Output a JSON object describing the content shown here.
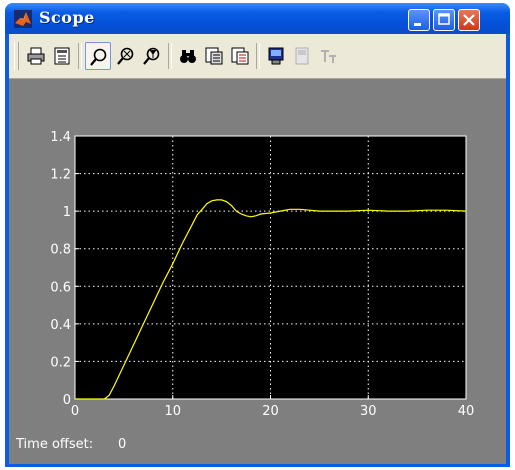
{
  "window": {
    "title": "Scope"
  },
  "toolbar": {
    "buttons": [
      {
        "icon": "print-icon"
      },
      {
        "icon": "parameters-icon"
      },
      {
        "icon": "zoom-icon",
        "pressed": true
      },
      {
        "icon": "zoom-x-icon"
      },
      {
        "icon": "zoom-y-icon"
      },
      {
        "icon": "autoscale-icon"
      },
      {
        "icon": "save-axes-icon"
      },
      {
        "icon": "restore-axes-icon"
      },
      {
        "icon": "floating-scope-icon"
      },
      {
        "icon": "lock-axes-icon",
        "disabled": true
      },
      {
        "icon": "signal-selection-icon",
        "disabled": true
      }
    ]
  },
  "status": {
    "time_offset_label": "Time offset:",
    "time_offset_value": "0"
  },
  "colors": {
    "plot_bg": "#000000",
    "figure_bg": "#7f7f7f",
    "line": "#ffff00",
    "grid": "#ffffff"
  },
  "chart_data": {
    "type": "line",
    "grid": true,
    "xlim": [
      0,
      40
    ],
    "ylim": [
      0,
      1.4
    ],
    "x_ticks": [
      "0",
      "10",
      "20",
      "30",
      "40"
    ],
    "y_ticks": [
      "0",
      "0.2",
      "0.4",
      "0.6",
      "0.8",
      "1",
      "1.2",
      "1.4"
    ],
    "series": [
      {
        "color": "#ffff00",
        "x": [
          0,
          3,
          3.5,
          4,
          5,
          6,
          7,
          8,
          9,
          10,
          11,
          12,
          12.5,
          13,
          13.5,
          14,
          14.5,
          15,
          15.5,
          16,
          16.5,
          17,
          17.5,
          18,
          18.5,
          19,
          20,
          21,
          22,
          23,
          24,
          25,
          26,
          28,
          30,
          32,
          34,
          36,
          38,
          40
        ],
        "y": [
          0,
          0,
          0.02,
          0.07,
          0.18,
          0.29,
          0.4,
          0.51,
          0.62,
          0.72,
          0.83,
          0.93,
          0.98,
          1.01,
          1.04,
          1.055,
          1.06,
          1.06,
          1.05,
          1.03,
          1.0,
          0.985,
          0.975,
          0.97,
          0.975,
          0.985,
          0.99,
          1.0,
          1.01,
          1.01,
          1.005,
          1.0,
          1.0,
          1.0,
          1.005,
          1.0,
          1.0,
          1.005,
          1.005,
          1.0
        ]
      }
    ]
  }
}
